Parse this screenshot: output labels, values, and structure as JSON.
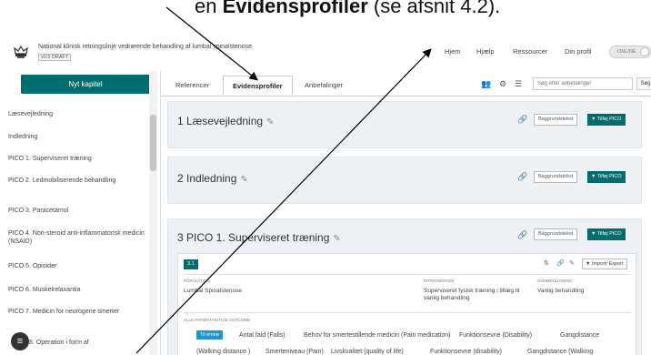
{
  "caption": {
    "prefix": "en ",
    "bold": "Evidensprofiler",
    "suffix": " (se afsnit 4.2)."
  },
  "app": {
    "title": "National klinisk retningslinje vedrørende behandling af lumbal spinalstenose",
    "version": "v0.5  DRAFT"
  },
  "topnav": {
    "home": "Hjem",
    "help": "Hjælp",
    "resources": "Ressourcer",
    "profile": "Din profil",
    "toggle": "ONLINE"
  },
  "sidebar": {
    "new_chapter": "Nyt kapitel",
    "items": [
      "Læsevejledning",
      "Indledning",
      "PICO 1. Superviseret træning",
      "PICO 2. Ledmobiliserende behandling",
      "PICO 3. Paracetamol",
      "PICO 4. Non-steroid anti-inflammatorisk medicin (NSAID)",
      "PICO 5. Opioider",
      "PICO 6. Muskelrelaxantia",
      "PICO 7. Medicin for neurogene smerter",
      "8. Operation i form af"
    ],
    "fab_icon": "≡"
  },
  "tabs": [
    "Referencer",
    "Evidensprofiler",
    "Anbefalinger"
  ],
  "toolbar": {
    "search_placeholder": "Søg efter anbefalinger",
    "search_btn": "Søg"
  },
  "sections": [
    {
      "title": "1 Læsevejledning",
      "bg_btn": "Baggrundstekst",
      "pico_btn": "▼ Tilføj PICO"
    },
    {
      "title": "2 Indledning",
      "bg_btn": "Baggrundstekst",
      "pico_btn": "▼ Tilføj PICO"
    },
    {
      "title": "3 PICO 1. Superviseret træning",
      "bg_btn": "Baggrundstekst",
      "pico_btn": "▼ Tilføj PICO"
    }
  ],
  "card": {
    "badge": "3.1",
    "export": "▼ Import/ Export",
    "population_label": "POPULATION",
    "population": "Lumbal Spinalstenose",
    "intervention_label": "INTERVENTION",
    "intervention": "Superviseret fysisk træning i tillæg til vanlig behandling",
    "comparison_label": "SAMMENLIGNING",
    "comparison": "Vanlig behandling",
    "outcome_label": "ALLE PATIENTVIGTIGE OUTCOME",
    "outcomes_row1": [
      "Til emne",
      "Antal fald (Falls)",
      "Behov for smertestillende medicin (Pain medication)",
      "Funktionsevne (Disability)",
      "Gangdistance"
    ],
    "outcomes_row2": [
      "(Walking distance )",
      "Smerteniveau (Pain)",
      "Livskvalitet (quality of life)",
      "Funktionsevne (disability)",
      "Gangdistance (Walking"
    ]
  },
  "colors": {
    "accent": "#006e6e",
    "panel": "#eef1f4",
    "selected": "#2196c8"
  }
}
